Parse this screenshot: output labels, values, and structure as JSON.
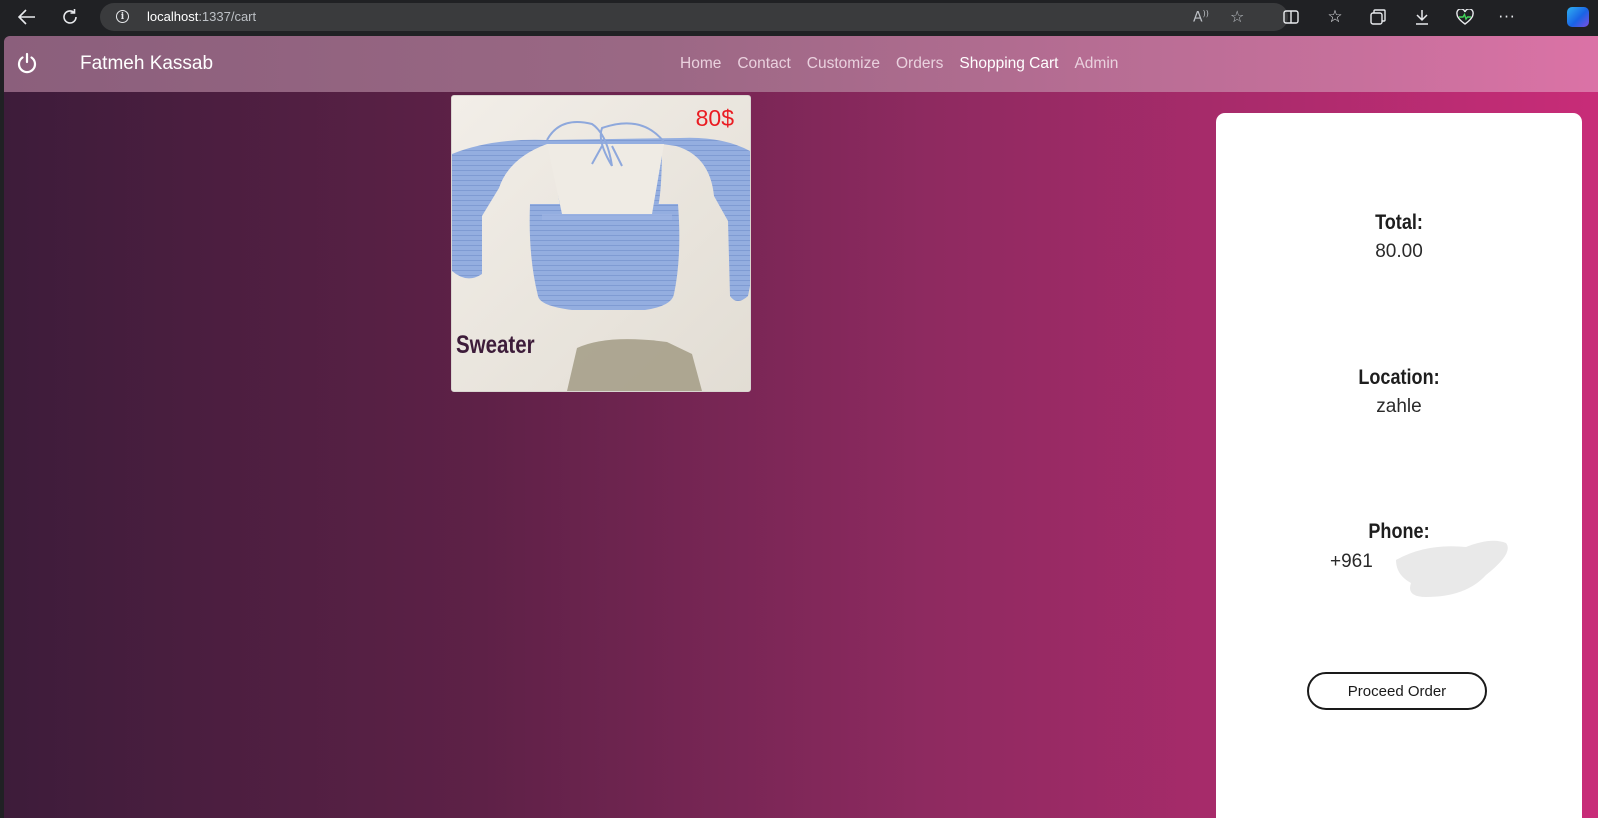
{
  "browser": {
    "url_host": "localhost",
    "url_path": ":1337/cart",
    "back_icon": "arrow-left-icon",
    "refresh_icon": "refresh-icon"
  },
  "navbar": {
    "brand": "Fatmeh Kassab",
    "power_icon": "power-icon",
    "items": [
      {
        "label": "Home"
      },
      {
        "label": "Contact"
      },
      {
        "label": "Customize"
      },
      {
        "label": "Orders"
      },
      {
        "label": "Shopping Cart",
        "active": true
      },
      {
        "label": "Admin"
      }
    ]
  },
  "cart": {
    "items": [
      {
        "name": "Sweater",
        "price": "80$",
        "image": "blue crochet sweater"
      }
    ]
  },
  "summary": {
    "total_label": "Total:",
    "total_value": "80.00",
    "location_label": "Location:",
    "location_value": "zahle",
    "phone_label": "Phone:",
    "phone_value": "+961",
    "proceed_label": "Proceed Order"
  },
  "colors": {
    "price": "#ea1c22",
    "panel": "#ffffff",
    "background_start": "#3d1c3a",
    "background_end": "#c82c78"
  }
}
